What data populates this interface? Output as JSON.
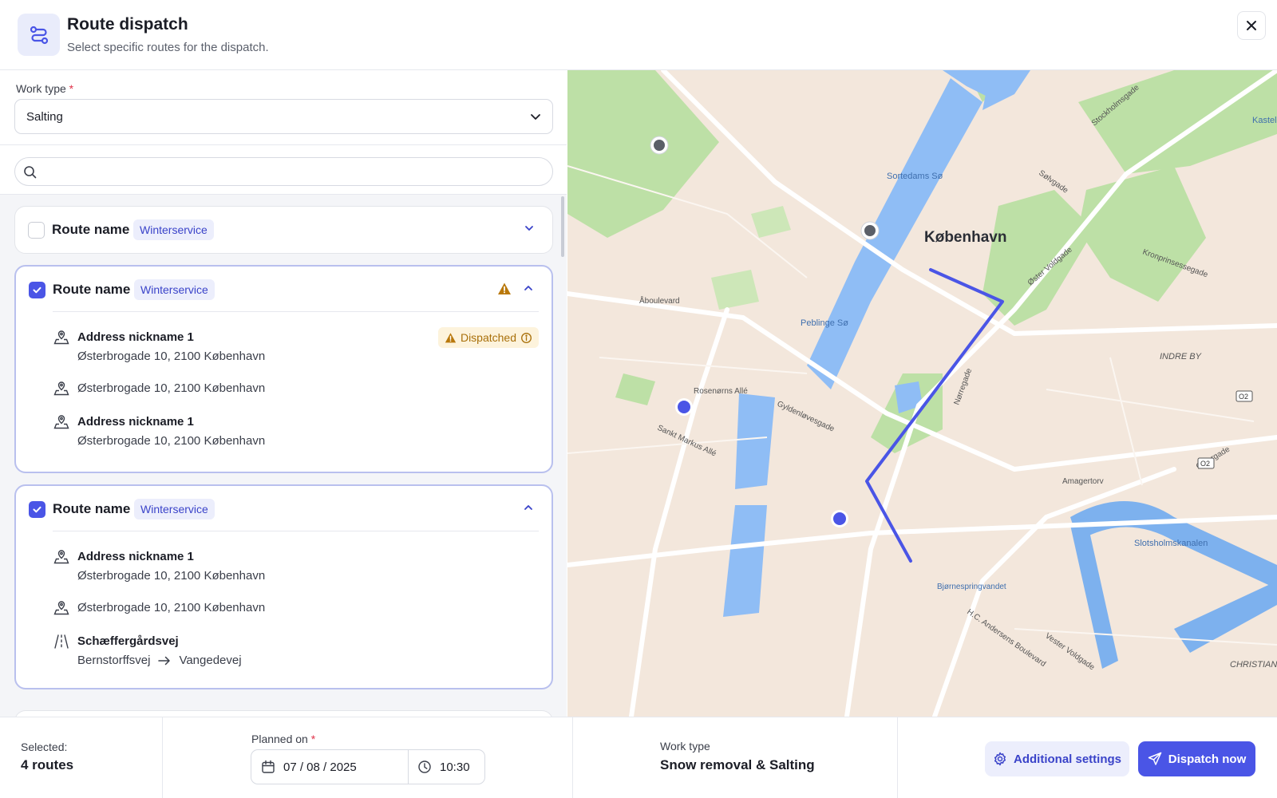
{
  "header": {
    "title": "Route dispatch",
    "subtitle": "Select specific routes for the dispatch.",
    "icon": "route-icon",
    "close_icon": "close-icon"
  },
  "work_type_field": {
    "label": "Work type",
    "required_mark": "*",
    "value": "Salting"
  },
  "search": {
    "placeholder": "",
    "value": ""
  },
  "routes": [
    {
      "name": "Route name",
      "tag": "Winterservice",
      "checked": false,
      "expanded": false
    },
    {
      "name": "Route name",
      "tag": "Winterservice",
      "checked": true,
      "expanded": true,
      "warning": true,
      "items": [
        {
          "type": "address",
          "title": "Address nickname 1",
          "line": "Østerbrogade 10, 2100 København",
          "badge": "Dispatched"
        },
        {
          "type": "address",
          "title": "",
          "line": "Østerbrogade 10, 2100 København"
        },
        {
          "type": "address",
          "title": "Address nickname 1",
          "line": "Østerbrogade 10, 2100 København"
        }
      ]
    },
    {
      "name": "Route name",
      "tag": "Winterservice",
      "checked": true,
      "expanded": true,
      "items": [
        {
          "type": "address",
          "title": "Address nickname 1",
          "line": "Østerbrogade 10, 2100 København"
        },
        {
          "type": "address",
          "title": "",
          "line": "Østerbrogade 10, 2100 København"
        },
        {
          "type": "road",
          "title": "Schæffergårdsvej",
          "from": "Bernstorffsvej",
          "to": "Vangedevej"
        }
      ]
    }
  ],
  "map": {
    "city_label": "København",
    "labels": {
      "sortedams": "Sortedams Sø",
      "peblinge": "Peblinge Sø",
      "indre_by": "INDRE BY",
      "christian": "CHRISTIAN",
      "slotsholms": "Slotsholmskanalen",
      "bjornesp": "Bjørnespringvandet",
      "kastel": "Kastel",
      "o2": "O2",
      "aboulevard": "Åboulevard",
      "rosenorns": "Rosenørns Allé",
      "sankt_markus": "Sankt Markus Allé",
      "gyldenlove": "Gyldenløvesgade",
      "amagertorv": "Amagertorv",
      "ostergade": "Østergade",
      "nørregade": "Nørregade",
      "vestervoldgade": "Vester Voldgade",
      "hc_andersens": "H.C. Andersens Boulevard",
      "ostervoldgade": "Øster Voldgade",
      "solvgade": "Sølvgade",
      "kronprinsessegade": "Kronprinsessegade",
      "stockholmsgade": "Stockholmsgade"
    },
    "route_color": "#4a55e6"
  },
  "footer": {
    "selected_label": "Selected:",
    "selected_value": "4 routes",
    "planned_label": "Planned on",
    "required_mark": "*",
    "date": "07 / 08 / 2025",
    "time": "10:30",
    "work_type_label": "Work type",
    "work_type_value": "Snow removal & Salting",
    "additional_settings": "Additional settings",
    "dispatch_now": "Dispatch now"
  },
  "colors": {
    "accent": "#4a55e6",
    "accent_soft": "#eceefc",
    "warning": "#a9700a",
    "warning_bg": "#fdf3dc"
  }
}
